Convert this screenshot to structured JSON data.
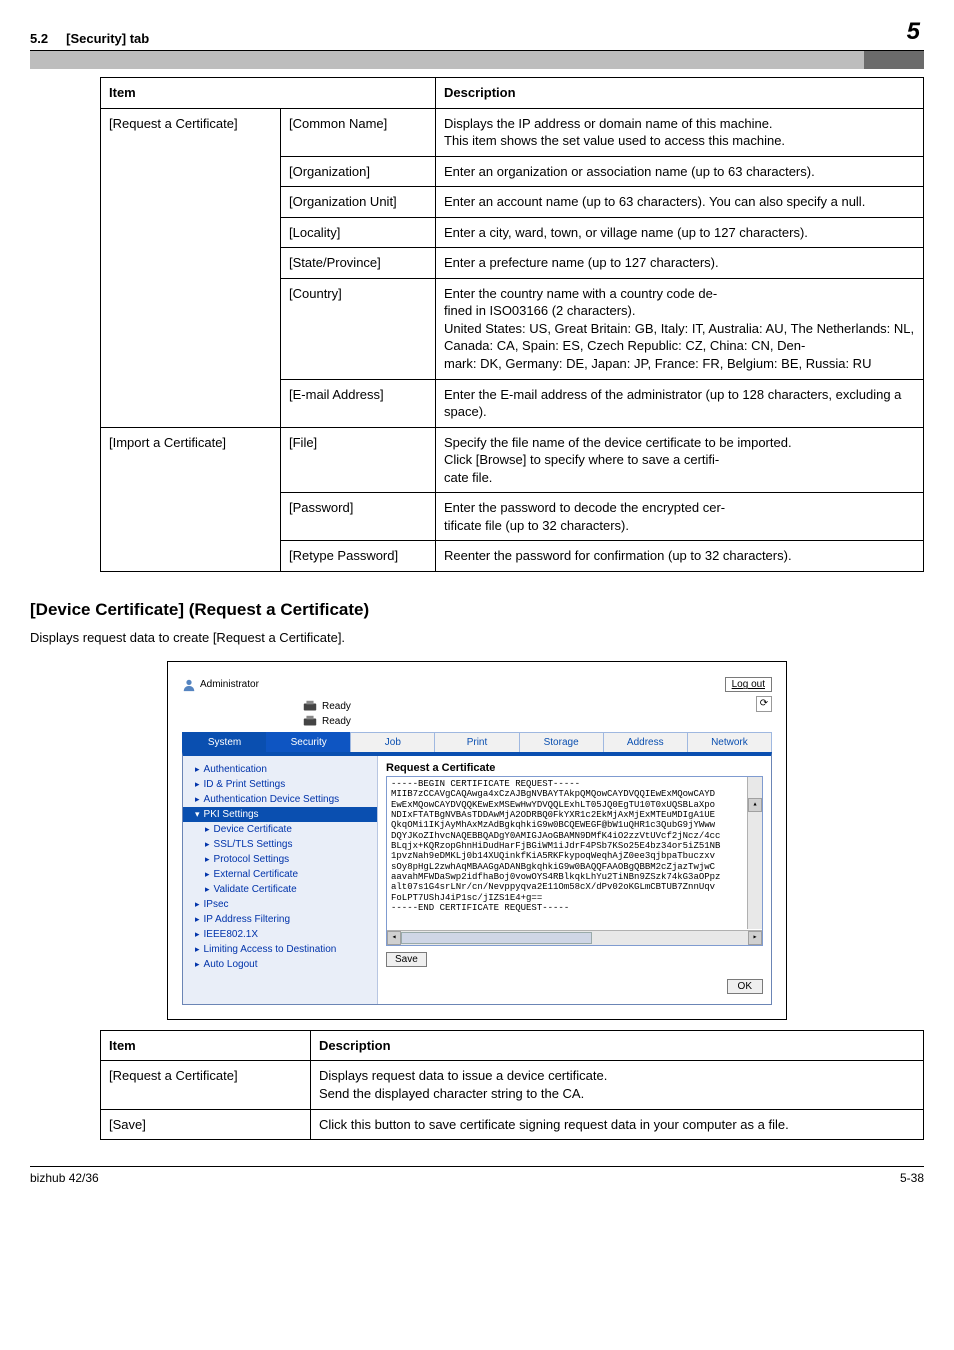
{
  "header": {
    "section_label": "5.2",
    "section_title": "[Security] tab",
    "page_accent_num": "5"
  },
  "table1": {
    "headers": {
      "item": "Item",
      "desc": "Description"
    },
    "group1_label": "[Request a Certificate]",
    "group1_rows": [
      {
        "field": "[Common Name]",
        "desc": "Displays the IP address or domain name of this machine.\nThis item shows the set value used to access this machine."
      },
      {
        "field": "[Organization]",
        "desc": "Enter an organization or association name (up to 63 characters)."
      },
      {
        "field": "[Organization Unit]",
        "desc": "Enter an account name (up to 63 characters). You can also specify a null."
      },
      {
        "field": "[Locality]",
        "desc": "Enter a city, ward, town, or village name (up to 127 characters)."
      },
      {
        "field": "[State/Province]",
        "desc": "Enter a prefecture name (up to 127 characters)."
      },
      {
        "field": "[Country]",
        "desc": "Enter the country name with a country code de-\nfined in ISO03166 (2 characters).\nUnited States: US, Great Britain: GB, Italy: IT, Australia: AU, The Netherlands: NL, Canada: CA, Spain: ES, Czech Republic: CZ, China: CN, Den-\nmark: DK, Germany: DE, Japan: JP, France: FR, Belgium: BE, Russia: RU"
      },
      {
        "field": "[E-mail Address]",
        "desc": "Enter the E-mail address of the administrator (up to 128 characters, excluding a space)."
      }
    ],
    "group2_label": "[Import a Certificate]",
    "group2_rows": [
      {
        "field": "[File]",
        "desc": "Specify the file name of the device certificate to be imported.\nClick [Browse] to specify where to save a certifi-\ncate file."
      },
      {
        "field": "[Password]",
        "desc": "Enter the password to decode the encrypted cer-\ntificate file (up to 32 characters)."
      },
      {
        "field": "[Retype Password]",
        "desc": "Reenter the password for confirmation (up to 32 characters)."
      }
    ]
  },
  "section2": {
    "title": "[Device Certificate] (Request a Certificate)",
    "lead": "Displays request data to create [Request a Certificate]."
  },
  "shot": {
    "admin_label": "Administrator",
    "logout": "Log out",
    "ready": "Ready",
    "tabs": {
      "system": "System",
      "security": "Security",
      "job": "Job",
      "print": "Print",
      "storage": "Storage",
      "address": "Address",
      "network": "Network"
    },
    "sidebar": {
      "auth": "Authentication",
      "idprint": "ID & Print Settings",
      "authdev": "Authentication Device Settings",
      "pki": "PKI Settings",
      "devcert": "Device Certificate",
      "ssltls": "SSL/TLS Settings",
      "protocol": "Protocol Settings",
      "extcert": "External Certificate",
      "valcert": "Validate Certificate",
      "ipsec": "IPsec",
      "ipfilter": "IP Address Filtering",
      "ieee": "IEEE802.1X",
      "limiting": "Limiting Access to Destination",
      "autologout": "Auto Logout"
    },
    "content": {
      "heading": "Request a Certificate",
      "cert_text": "-----BEGIN CERTIFICATE REQUEST-----\nMIIB7zCCAVgCAQAwga4xCzAJBgNVBAYTAkpQMQowCAYDVQQIEwExMQowCAYD\nEwExMQowCAYDVQQKEwExMSEwHwYDVQQLExhLT05JQ0EgTU10T0xUQSBLaXpo\nNDIxFTATBgNVBAsTDDAwMjA2ODRBQ0FkYXR1c2EkMjAxMjExMTEuMDIgA1UE\nQkqOMi1IKjAyMhAxMzAdBgkqhkiG9w0BCQEWEGF@bW1uQHR1c3QubG9jYWww\nDQYJKoZIhvcNAQEBBQADgY0AMIGJAoGBAMN9DMfK4iO2zzVtUVcf2jNcz/4cc\nBLqjx+KQRzopGhnHiDudHarFjBGiWM1iJdrF4PSb7KSo25E4bz34or5iZ51NB\n1pvzNah9eDMKLj0b14XUQinkfKiA5RKFkypoqWeqhAjZ0ee3qjbpaTbuczxv\nsOy8pHgL2zwhAqMBAAGgADANBgkqhkiG9w0BAQQFAAOBgQBBM2cZjazTwjwC\naavahMFWDaSwp2idfhaBoj0vowOYS4RBlkqkLhYu2TiNBn9ZSzk74kG3aOPpz\nalt07s1G4srLNr/cn/Nevppyqva2E11Om58cX/dPv02oKGLmCBTUB7ZnnUqv\nFoLPT7UShJ4iP1sc/jIZS1E4+g==\n-----END CERTIFICATE REQUEST-----",
      "save": "Save",
      "ok": "OK"
    }
  },
  "table3": {
    "headers": {
      "item": "Item",
      "desc": "Description"
    },
    "rows": [
      {
        "item": "[Request a Certificate]",
        "desc": "Displays request data to issue a device certificate.\nSend the displayed character string to the CA."
      },
      {
        "item": "[Save]",
        "desc": "Click this button to save certificate signing request data in your computer as a file."
      }
    ]
  },
  "footer": {
    "model": "bizhub 42/36",
    "page": "5-38"
  }
}
